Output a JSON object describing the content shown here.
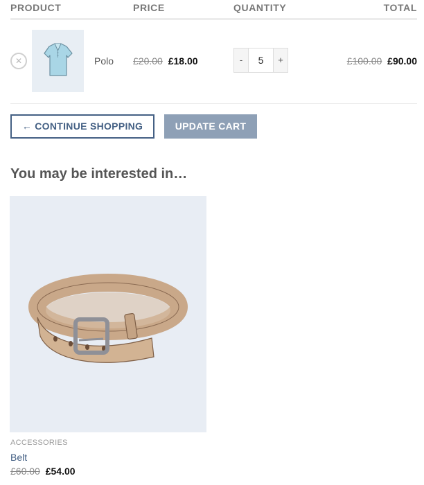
{
  "cart": {
    "headers": {
      "product": "PRODUCT",
      "price": "PRICE",
      "quantity": "QUANTITY",
      "total": "TOTAL"
    },
    "item": {
      "remove_icon": "close-circle-icon",
      "name": "Polo",
      "image": "polo-shirt-icon",
      "price_old": "£20.00",
      "price_new": "£18.00",
      "quantity": "5",
      "qty_minus": "-",
      "qty_plus": "+",
      "total_old": "£100.00",
      "total_new": "£90.00"
    }
  },
  "actions": {
    "continue_label": "← CONTINUE SHOPPING",
    "update_label": "UPDATE CART",
    "accent_color": "#446084"
  },
  "related": {
    "title": "You may be interested in…",
    "product": {
      "category": "ACCESSORIES",
      "name": "Belt",
      "image": "belt-icon",
      "price_old": "£60.00",
      "price_new": "£54.00"
    }
  }
}
